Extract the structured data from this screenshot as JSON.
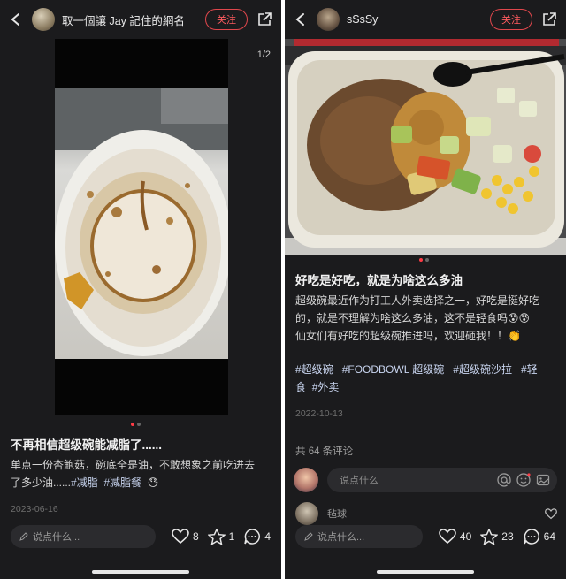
{
  "left": {
    "username": "取一個讓 Jay 記住的網名",
    "follow_label": "关注",
    "page_indicator": "1/2",
    "title": "不再相信超级碗能减脂了......",
    "body_line1": "单点一份杏鲍菇，碗底全是油，不敢想象之前吃进去",
    "body_line2_text": "了多少油......",
    "tags": [
      "#减脂",
      "#减脂餐"
    ],
    "emoji": "😓",
    "date": "2023-06-16",
    "say_placeholder": "说点什么...",
    "likes": "8",
    "stars": "1",
    "comments": "4"
  },
  "right": {
    "username": "sSsSy",
    "follow_label": "关注",
    "title": "好吃是好吃，就是为啥这么多油",
    "body_line1": "超级碗最近作为打工人外卖选择之一，好吃是挺好吃",
    "body_line2": "的，就是不理解为啥这么多油，这不是轻食吗😰😰",
    "body_line3": "仙女们有好吃的超级碗推进吗，欢迎砸我！！👏",
    "tags_line1": [
      "#超级碗",
      "#FOODBOWL 超级碗",
      "#超级碗沙拉",
      "#轻"
    ],
    "tags_line2": [
      "食",
      "#外卖"
    ],
    "date": "2022-10-13",
    "comments_count": "共 64 条评论",
    "comment_placeholder": "说点什么",
    "first_comment_name": "毡球",
    "say_placeholder": "说点什么...",
    "likes": "40",
    "stars": "23",
    "comments": "64"
  },
  "icons": [
    "back-icon",
    "share-icon",
    "pencil-icon",
    "heart-icon",
    "star-icon",
    "comment-icon",
    "at-icon",
    "emoji-icon",
    "image-icon"
  ],
  "colors": {
    "background": "#1b1b1d",
    "accent": "#ff3b45",
    "tag": "#c8d4ef"
  }
}
